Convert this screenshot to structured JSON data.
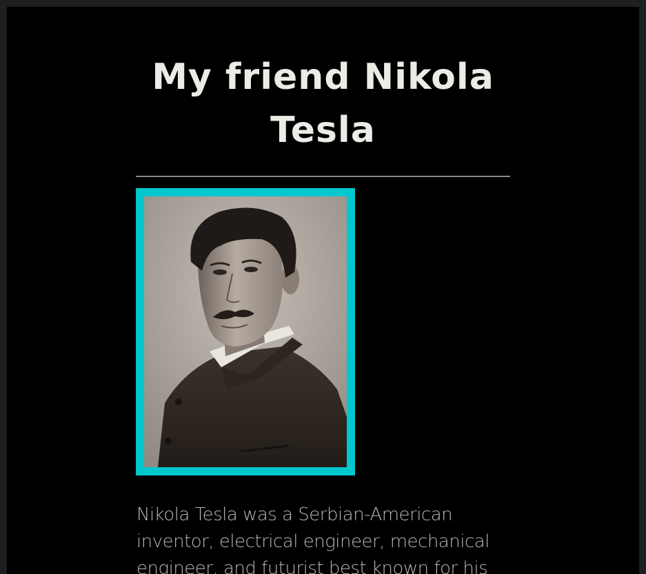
{
  "header": {
    "title_line1": "My friend Nikola",
    "title_line2": "Tesla"
  },
  "portrait": {
    "subject": "portrait-photo-of-nikola-tesla",
    "frame_color": "#00c8cc"
  },
  "main": {
    "bio_text": "Nikola Tesla was a Serbian-American inventor, electrical engineer, mechanical engineer, and futurist best known for his"
  },
  "colors": {
    "background": "#000000",
    "outer_background": "#1d1f20",
    "title": "#ecebe6",
    "body_text": "#b9b7b2",
    "accent": "#00c8cc"
  }
}
